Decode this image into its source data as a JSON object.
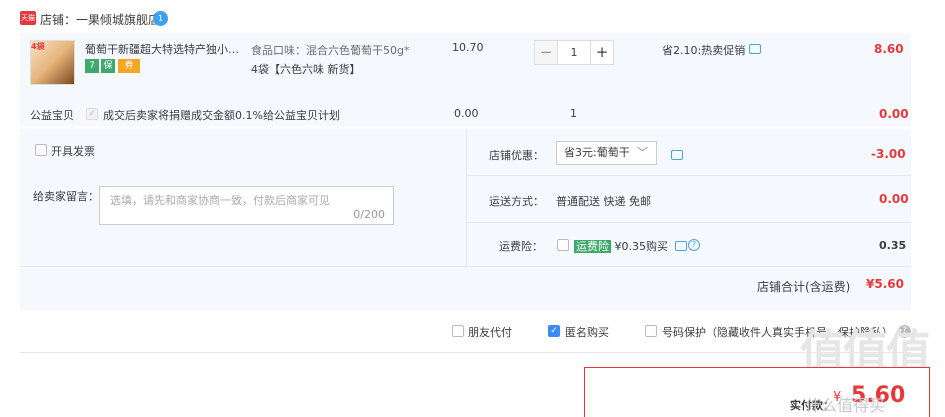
{
  "shop": {
    "badge": "天猫",
    "label": "店铺：一果倾城旗舰店",
    "ww": "1"
  },
  "item": {
    "thumb_tag": "4袋",
    "title": "葡萄干新疆超大特选特产独小包...",
    "services": [
      "7",
      "保",
      "券"
    ],
    "sku_line1": "食品口味：混合六色葡萄干50g*",
    "sku_line2": "4袋【六色六味 新货】",
    "price": "10.70",
    "qty": "1",
    "qty_minus": "−",
    "qty_plus": "+",
    "promo": "省2.10:热卖促销",
    "subtotal": "8.60"
  },
  "charity": {
    "label": "公益宝贝",
    "desc": "成交后卖家将捐赠成交金额0.1%给公益宝贝计划",
    "price": "0.00",
    "qty": "1",
    "subtotal": "0.00"
  },
  "invoice": {
    "label": "开具发票"
  },
  "message": {
    "label": "给卖家留言：",
    "placeholder": "选填，请先和商家协商一致，付款后商家可见",
    "count": "0/200"
  },
  "shop_discount": {
    "label": "店铺优惠：",
    "selected": "省3元:葡萄干",
    "amount": "-3.00"
  },
  "shipping": {
    "label": "运送方式：",
    "value": "普通配送 快递 免邮",
    "amount": "0.00"
  },
  "insurance": {
    "label": "运费险：",
    "tag": "运费险",
    "price": "¥0.35购买",
    "amount": "0.35"
  },
  "total": {
    "label": "店铺合计(含运费)",
    "amount": "¥5.60"
  },
  "options": {
    "friend_pay": "朋友代付",
    "anonymous": "匿名购买",
    "number_protect": "号码保护（隐藏收件人真实手机号，保护隐私）",
    "help": "?"
  },
  "pay": {
    "label": "实付款：",
    "amount": "5.60",
    "currency": "¥"
  },
  "watermark": {
    "big": "值值值",
    "small": "什么值得买"
  },
  "colors": {
    "accent": "#e4393c",
    "row_bg": "#f5f9fe",
    "check_blue": "#3d8af7"
  }
}
